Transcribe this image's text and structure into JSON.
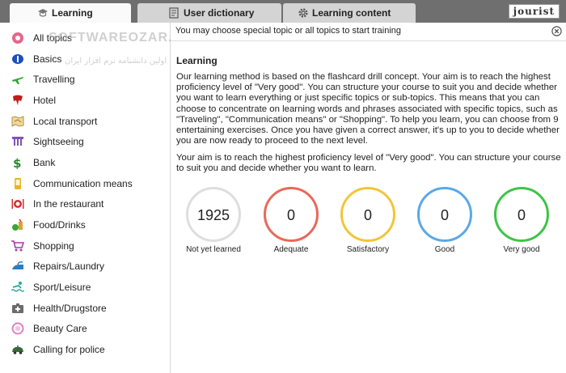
{
  "tabs": [
    {
      "label": "Learning",
      "icon": "learning-icon",
      "active": true
    },
    {
      "label": "User dictionary",
      "icon": "dictionary-icon",
      "active": false
    },
    {
      "label": "Learning content",
      "icon": "gear-icon",
      "active": false
    }
  ],
  "logo": "jourist",
  "watermark": "SOFTWAREOZAR.COM",
  "watermark_sub": "اولین دانشنامه نرم افزار ایران",
  "sidebar": {
    "items": [
      {
        "label": "All topics",
        "icon": "all-topics-icon",
        "color": "#e5668b",
        "selected": true
      },
      {
        "label": "Basics",
        "icon": "basics-icon",
        "color": "#1d4fbf"
      },
      {
        "label": "Travelling",
        "icon": "airplane-icon",
        "color": "#2aa52a"
      },
      {
        "label": "Hotel",
        "icon": "hotel-icon",
        "color": "#c01c1c"
      },
      {
        "label": "Local transport",
        "icon": "map-icon",
        "color": "#c8a24a"
      },
      {
        "label": "Sightseeing",
        "icon": "columns-icon",
        "color": "#8052b8"
      },
      {
        "label": "Bank",
        "icon": "dollar-icon",
        "color": "#2b8a2b"
      },
      {
        "label": "Communication means",
        "icon": "phone-icon",
        "color": "#e7b520"
      },
      {
        "label": "In the restaurant",
        "icon": "restaurant-icon",
        "color": "#d03030"
      },
      {
        "label": "Food/Drinks",
        "icon": "food-icon",
        "color": "#39a539"
      },
      {
        "label": "Shopping",
        "icon": "cart-icon",
        "color": "#a63aa6"
      },
      {
        "label": "Repairs/Laundry",
        "icon": "iron-icon",
        "color": "#2c7fbf"
      },
      {
        "label": "Sport/Leisure",
        "icon": "swimmer-icon",
        "color": "#2aaa9a"
      },
      {
        "label": "Health/Drugstore",
        "icon": "firstaid-icon",
        "color": "#6c6c6c"
      },
      {
        "label": "Beauty Care",
        "icon": "beauty-icon",
        "color": "#e080c0"
      },
      {
        "label": "Calling for police",
        "icon": "police-car-icon",
        "color": "#3a6a3a"
      }
    ]
  },
  "infobar": {
    "text": "You may choose special topic or all topics to start training"
  },
  "main": {
    "title": "Learning",
    "paragraphs": [
      "Our learning method is based on the flashcard drill concept. Your aim is to reach the highest proficiency level of \"Very good\". You can structure your course to suit you and decide whether you want to learn everything or just specific topics or sub-topics. This means that you can choose to concentrate on learning words and phrases associated with specific topics, such as \"Traveling\", \"Communication means\" or \"Shopping\". To help you learn, you can choose from 9 entertaining exercises. Once you have given a correct answer, it's up to you to decide whether you are now ready to proceed to the next level.",
      "Your aim is to reach the highest proficiency level of \"Very good\". You can structure your course to suit you and decide whether you want to learn."
    ],
    "stats": [
      {
        "value": "1925",
        "label": "Not yet learned",
        "color": "#dedede"
      },
      {
        "value": "0",
        "label": "Adequate",
        "color": "#e8695a"
      },
      {
        "value": "0",
        "label": "Satisfactory",
        "color": "#f2c53a"
      },
      {
        "value": "0",
        "label": "Good",
        "color": "#5aa9e6"
      },
      {
        "value": "0",
        "label": "Very good",
        "color": "#3ec447"
      }
    ]
  }
}
